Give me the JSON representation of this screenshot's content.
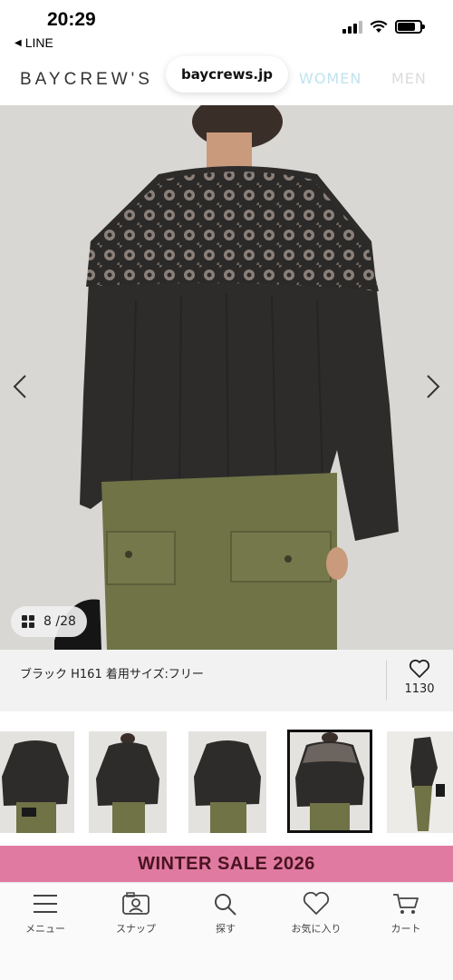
{
  "status_bar": {
    "time": "20:29",
    "back_app": "LINE"
  },
  "browser": {
    "url": "baycrews.jp"
  },
  "header": {
    "logo": "BAYCREW'S",
    "nav": [
      "WOMEN",
      "MEN"
    ],
    "nav_colors": {
      "women": "#bfe3ef",
      "men": "#dcdcdc"
    }
  },
  "gallery": {
    "current": "8",
    "total": "28",
    "counter_text": "8 /28",
    "prev_icon": "chevron-left-icon",
    "next_icon": "chevron-right-icon",
    "thumbnails_count": 5,
    "selected_thumbnail_index": 3
  },
  "caption": {
    "text": "ブラック H161 着用サイズ:フリー",
    "favorite_count": "1130",
    "favorite_icon": "heart-icon"
  },
  "banner": {
    "text": "WINTER SALE 2026",
    "color": "#e07aa0"
  },
  "tabs": [
    {
      "label": "メニュー",
      "icon": "menu-icon"
    },
    {
      "label": "スナップ",
      "icon": "snap-icon"
    },
    {
      "label": "探す",
      "icon": "search-icon"
    },
    {
      "label": "お気に入り",
      "icon": "heart-icon"
    },
    {
      "label": "カート",
      "icon": "cart-icon"
    }
  ]
}
